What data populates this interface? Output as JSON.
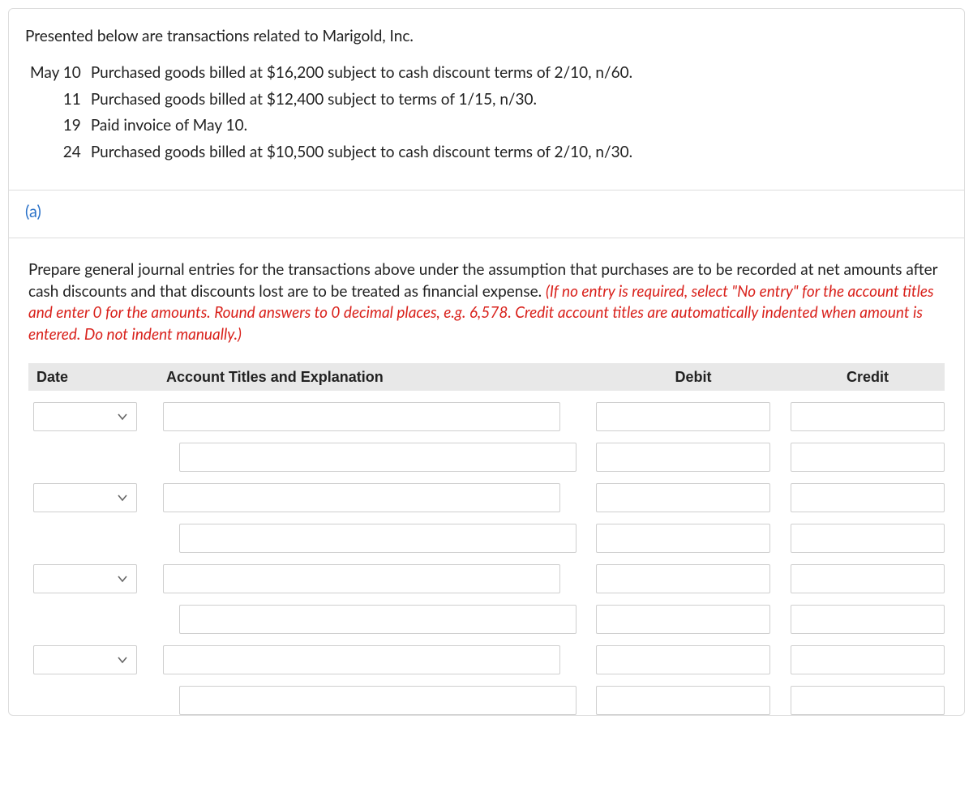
{
  "intro": "Presented below are transactions related to Marigold, Inc.",
  "transactions": [
    {
      "month": "May 10",
      "day": "",
      "desc": "Purchased goods billed at $16,200 subject to cash discount terms of 2/10, n/60."
    },
    {
      "month": "",
      "day": "11",
      "desc": "Purchased goods billed at $12,400 subject to terms of 1/15, n/30."
    },
    {
      "month": "",
      "day": "19",
      "desc": "Paid invoice of May 10."
    },
    {
      "month": "",
      "day": "24",
      "desc": "Purchased goods billed at $10,500 subject to cash discount terms of 2/10, n/30."
    }
  ],
  "part_label": "(a)",
  "instructions_plain": "Prepare general journal entries for the transactions above under the assumption that purchases are to be recorded at net amounts after cash discounts and that discounts lost are to be treated as financial expense. ",
  "instructions_em": "(If no entry is required, select \"No entry\" for the account titles and enter 0 for the amounts. Round answers to 0 decimal places, e.g. 6,578. Credit account titles are automatically indented when amount is entered. Do not indent manually.)",
  "headers": {
    "date": "Date",
    "acct": "Account Titles and Explanation",
    "debit": "Debit",
    "credit": "Credit"
  }
}
